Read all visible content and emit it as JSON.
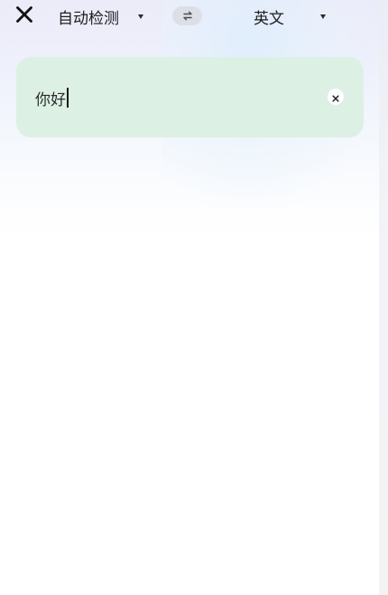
{
  "header": {
    "close_icon": "close-icon",
    "source_language": "自动检测",
    "swap_icon": "swap-arrows-icon",
    "target_language": "英文",
    "dropdown_icon": "caret-down-icon"
  },
  "input": {
    "text": "你好",
    "clear_icon": "clear-icon"
  },
  "colors": {
    "input_card_bg": "#ddf0e4",
    "text": "#1c1c1e",
    "swap_pill_bg": "#dcdfe6"
  }
}
